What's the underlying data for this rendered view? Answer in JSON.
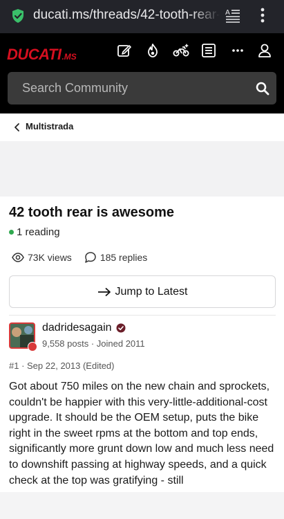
{
  "browser": {
    "url": "ducati.ms/threads/42-tooth-rear-",
    "icons": [
      "shield-check-icon",
      "reader-mode-icon",
      "more-vert-icon"
    ]
  },
  "site": {
    "logo_brand": "DUCATI",
    "logo_tld": ".MS",
    "header_icons": [
      "edit-icon",
      "fire-icon",
      "motorcycle-icon",
      "list-icon",
      "more-horizontal-icon",
      "user-icon"
    ],
    "search_placeholder": "Search Community",
    "accent_color": "#d50f1f"
  },
  "breadcrumb": {
    "label": "Multistrada"
  },
  "thread": {
    "title": "42 tooth rear is awesome",
    "reading": "1 reading",
    "views": "73K views",
    "replies": "185 replies",
    "jump_label": "Jump to Latest"
  },
  "post": {
    "username": "dadridesagain",
    "user_meta": "9,558 posts · Joined 2011",
    "post_meta": "#1 · Sep 22, 2013 (Edited)",
    "body": "Got about 750 miles on the new chain and sprockets, couldn't be happier with this very-little-additional-cost upgrade. It should be the OEM setup, puts the bike right in the sweet rpms at the bottom and top ends, significantly more grunt down low and much less need to downshift passing at highway speeds, and a quick check at the top was gratifying - still"
  }
}
